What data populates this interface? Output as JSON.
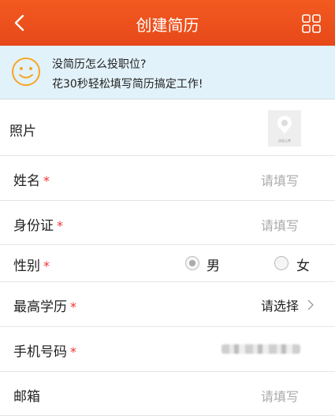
{
  "header": {
    "title": "创建简历",
    "back_icon": "chevron-left-icon",
    "menu_icon": "grid-icon",
    "accent": "#ec511c"
  },
  "tip": {
    "icon": "smiley-icon",
    "line1": "没简历怎么投职位?",
    "line2": "花30秒轻松填写简历搞定工作!"
  },
  "form": {
    "photo": {
      "label": "照片",
      "caption": "点击上传"
    },
    "name": {
      "label": "姓名",
      "required": "*",
      "placeholder": "请填写"
    },
    "id_card": {
      "label": "身份证",
      "required": "*",
      "placeholder": "请填写"
    },
    "gender": {
      "label": "性别",
      "required": "*",
      "option_male": "男",
      "option_female": "女",
      "selected": "男"
    },
    "education": {
      "label": "最高学历",
      "required": "*",
      "value": "请选择"
    },
    "phone": {
      "label": "手机号码",
      "required": "*"
    },
    "email": {
      "label": "邮箱",
      "placeholder": "请填写"
    }
  }
}
